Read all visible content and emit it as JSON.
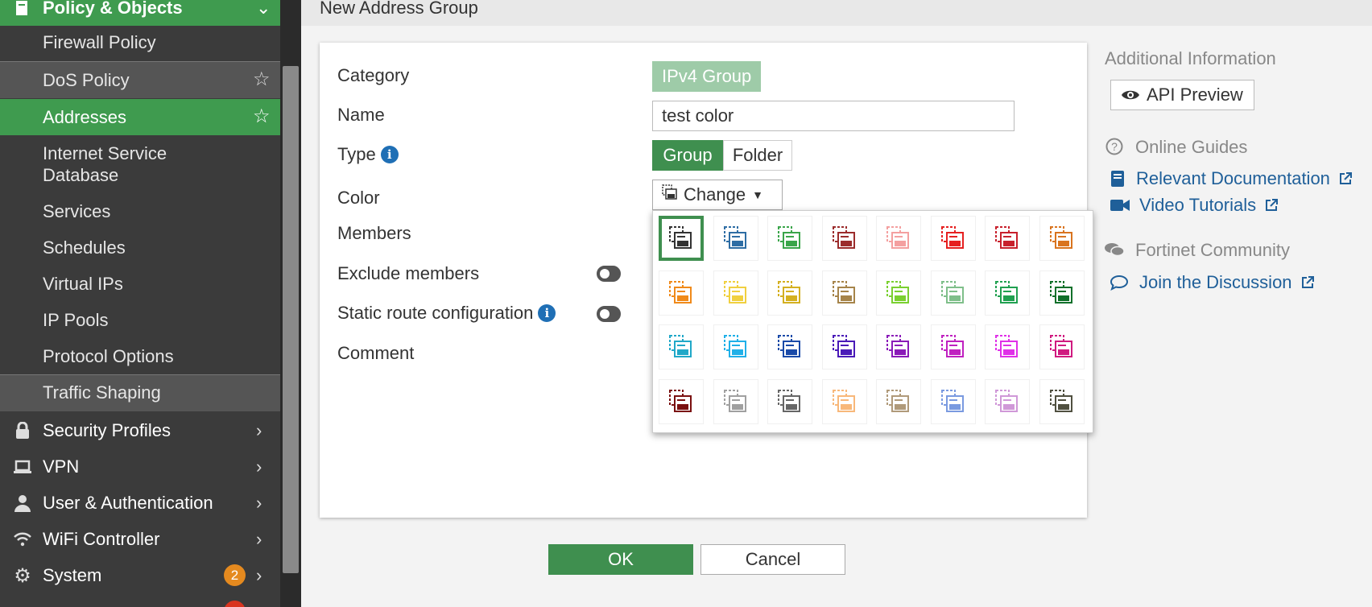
{
  "sidebar": {
    "section_title": "Policy & Objects",
    "items": [
      {
        "label": "Firewall Policy"
      },
      {
        "label": "DoS Policy"
      },
      {
        "label": "Addresses"
      },
      {
        "label": "Internet Service"
      },
      {
        "label": "Database"
      },
      {
        "label": "Services"
      },
      {
        "label": "Schedules"
      },
      {
        "label": "Virtual IPs"
      },
      {
        "label": "IP Pools"
      },
      {
        "label": "Protocol Options"
      },
      {
        "label": "Traffic Shaping"
      }
    ],
    "sections": [
      {
        "label": "Security Profiles"
      },
      {
        "label": "VPN"
      },
      {
        "label": "User & Authentication"
      },
      {
        "label": "WiFi Controller"
      },
      {
        "label": "System",
        "badge": "2"
      }
    ]
  },
  "page": {
    "title": "New Address Group"
  },
  "form": {
    "category_label": "Category",
    "category_value": "IPv4 Group",
    "name_label": "Name",
    "name_value": "test color",
    "type_label": "Type",
    "type_options": [
      "Group",
      "Folder"
    ],
    "type_selected": "Group",
    "color_label": "Color",
    "change_label": "Change",
    "members_label": "Members",
    "exclude_label": "Exclude members",
    "static_route_label": "Static route configuration",
    "comment_label": "Comment"
  },
  "palette": {
    "selected_index": 0,
    "colors": [
      "#333333",
      "#2e6da4",
      "#3aa54a",
      "#9b2c2c",
      "#f4a0a0",
      "#e62020",
      "#c8202c",
      "#d9741f",
      "#f08a1a",
      "#f0d040",
      "#d4b020",
      "#a6844a",
      "#7ad030",
      "#7fbf8a",
      "#20a050",
      "#10702a",
      "#20a8c8",
      "#20b0e8",
      "#1a4aa8",
      "#4a1ab8",
      "#8a1ab8",
      "#c020c0",
      "#e030e8",
      "#d01a80",
      "#7a1010",
      "#a0a0a0",
      "#666666",
      "#f8b87a",
      "#b09a7a",
      "#7a9ae0",
      "#d098d8",
      "#505040"
    ]
  },
  "right": {
    "additional_info": "Additional Information",
    "api_preview": "API Preview",
    "online_guides": "Online Guides",
    "relevant_docs": "Relevant Documentation",
    "video_tutorials": "Video Tutorials",
    "community": "Fortinet Community",
    "join_discussion": "Join the Discussion"
  },
  "buttons": {
    "ok": "OK",
    "cancel": "Cancel"
  }
}
